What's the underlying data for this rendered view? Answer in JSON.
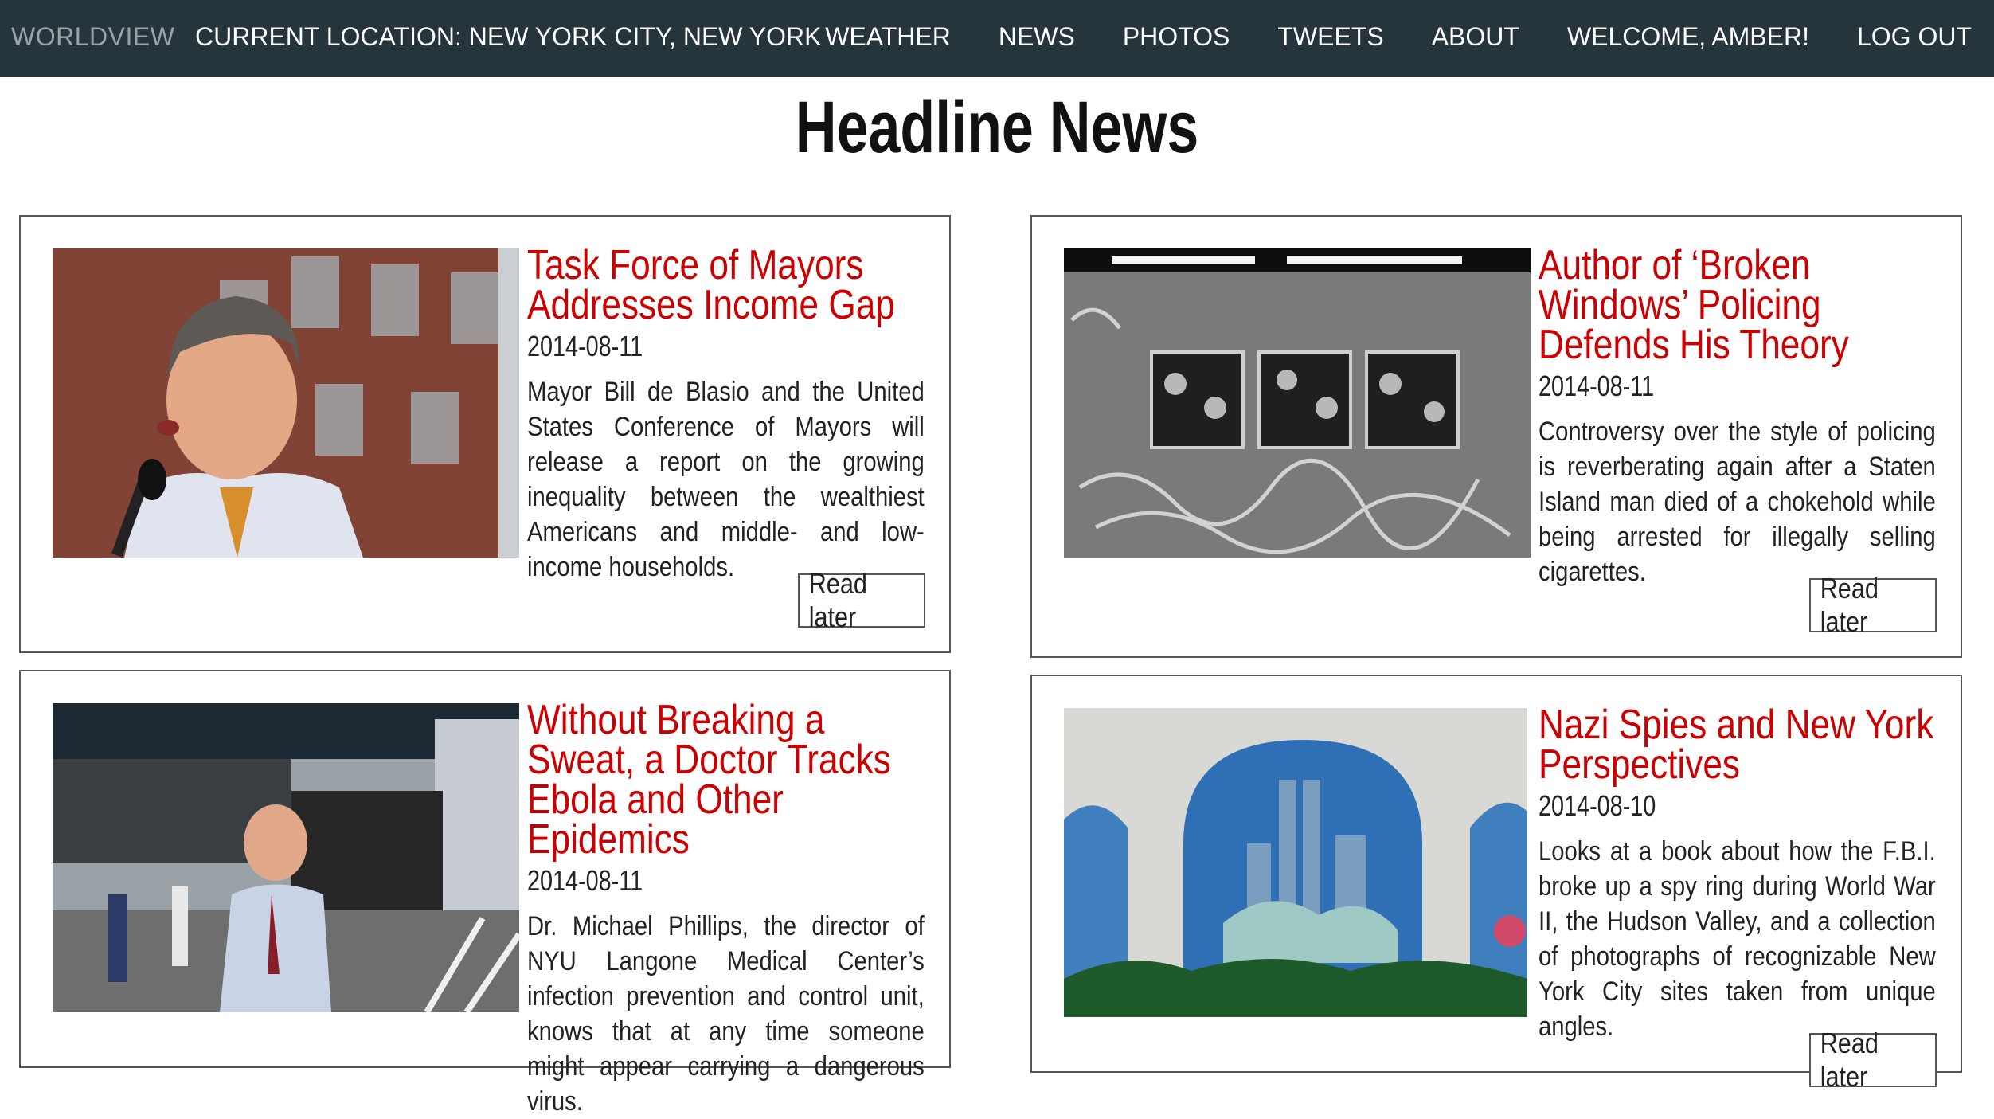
{
  "nav": {
    "brand": "WORLDVIEW",
    "location": "CURRENT LOCATION: NEW YORK CITY, NEW YORK",
    "links": [
      "WEATHER",
      "NEWS",
      "PHOTOS",
      "TWEETS",
      "ABOUT",
      "WELCOME, AMBER!",
      "LOG OUT"
    ]
  },
  "page_title": "Headline News",
  "articles": [
    {
      "title": "Task Force of Mayors Addresses Income Gap",
      "date": "2014-08-11",
      "summary": "Mayor Bill de Blasio and the United States Conference of Mayors will release a report on the growing inequality between the wealthiest Americans and middle- and low-income households.",
      "button": "Read later",
      "image": "mayor-speaking-photo"
    },
    {
      "title": "Author of ‘Broken Windows’ Policing Defends His Theory",
      "date": "2014-08-11",
      "summary": "Controversy over the style of policing is reverberating again after a Staten Island man died of a chokehold while being arrested for illegally selling cigarettes.",
      "button": "Read later",
      "image": "graffiti-subway-car-photo"
    },
    {
      "title": "Without Breaking a Sweat, a Doctor Tracks Ebola and Other Epidemics",
      "date": "2014-08-11",
      "summary": "Dr. Michael Phillips, the director of NYU Langone Medical Center’s infection prevention and control unit, knows that at any time someone might appear carrying a dangerous virus.",
      "button": "Read later",
      "image": "doctor-street-photo"
    },
    {
      "title": "Nazi Spies and New York Perspectives",
      "date": "2014-08-10",
      "summary": "Looks at a book about how the F.B.I. broke up a spy ring during World War II, the Hudson Valley, and a collection of photographs of recognizable New York City sites taken from unique angles.",
      "button": "Read later",
      "image": "skyline-mural-photo"
    }
  ],
  "colors": {
    "nav_bg": "#26343c",
    "headline_red": "#cc0000"
  }
}
